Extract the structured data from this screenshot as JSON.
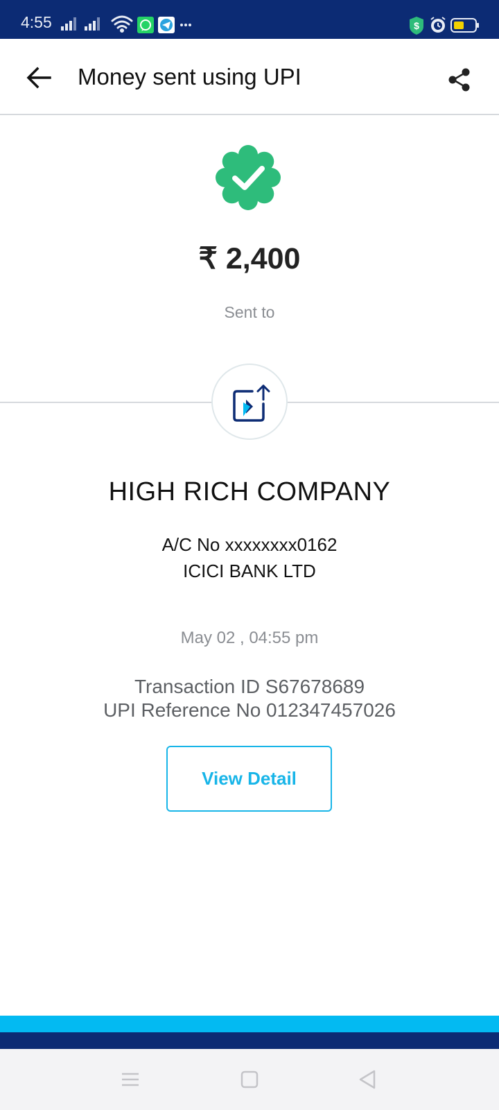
{
  "status_bar": {
    "time": "4:55",
    "left_icons": [
      "signal-icon",
      "signal-icon",
      "wifi-icon",
      "whatsapp-icon",
      "telegram-icon",
      "more-notifications-icon"
    ],
    "right_icons": [
      "security-shield-icon",
      "alarm-icon",
      "battery-icon"
    ]
  },
  "header": {
    "title": "Money sent using UPI",
    "back_icon": "arrow-left-icon",
    "share_icon": "share-icon"
  },
  "transaction": {
    "status_icon": "verified-check-icon",
    "amount": "₹ 2,400",
    "sent_to_label": "Sent to",
    "bank_icon": "bank-transfer-icon",
    "payee_name": "HIGH RICH COMPANY",
    "account": "A/C No xxxxxxxx0162",
    "bank": "ICICI BANK LTD",
    "datetime": "May 02 , 04:55 pm",
    "transaction_id": "Transaction ID S67678689",
    "upi_reference": "UPI Reference No 012347457026",
    "view_detail_label": "View Detail"
  },
  "nav_bar": {
    "items": [
      "menu-icon",
      "home-square-icon",
      "back-triangle-icon"
    ]
  },
  "colors": {
    "brand_navy": "#0c2b74",
    "brand_cyan": "#03baf2",
    "success_green": "#2ebc7b",
    "button_blue": "#18b5e8"
  }
}
